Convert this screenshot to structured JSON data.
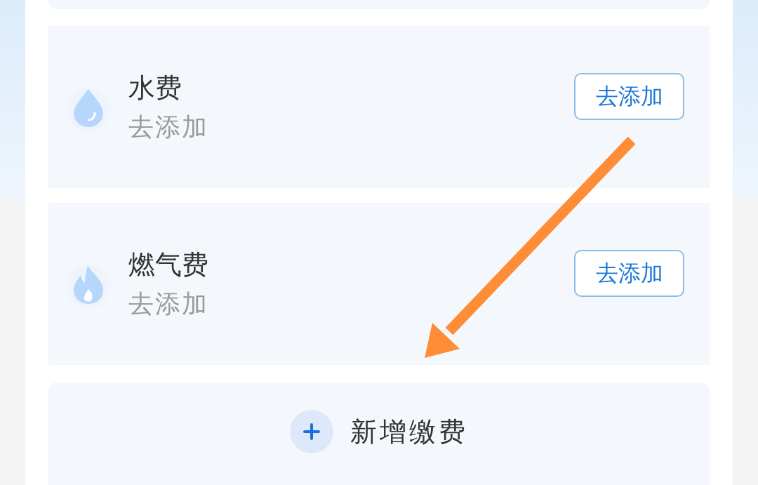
{
  "bills": [
    {
      "kind": "water",
      "title": "水费",
      "status": "去添加",
      "button": "去添加"
    },
    {
      "kind": "gas",
      "title": "燃气费",
      "status": "去添加",
      "button": "去添加"
    }
  ],
  "add_button": {
    "label": "新增缴费"
  }
}
